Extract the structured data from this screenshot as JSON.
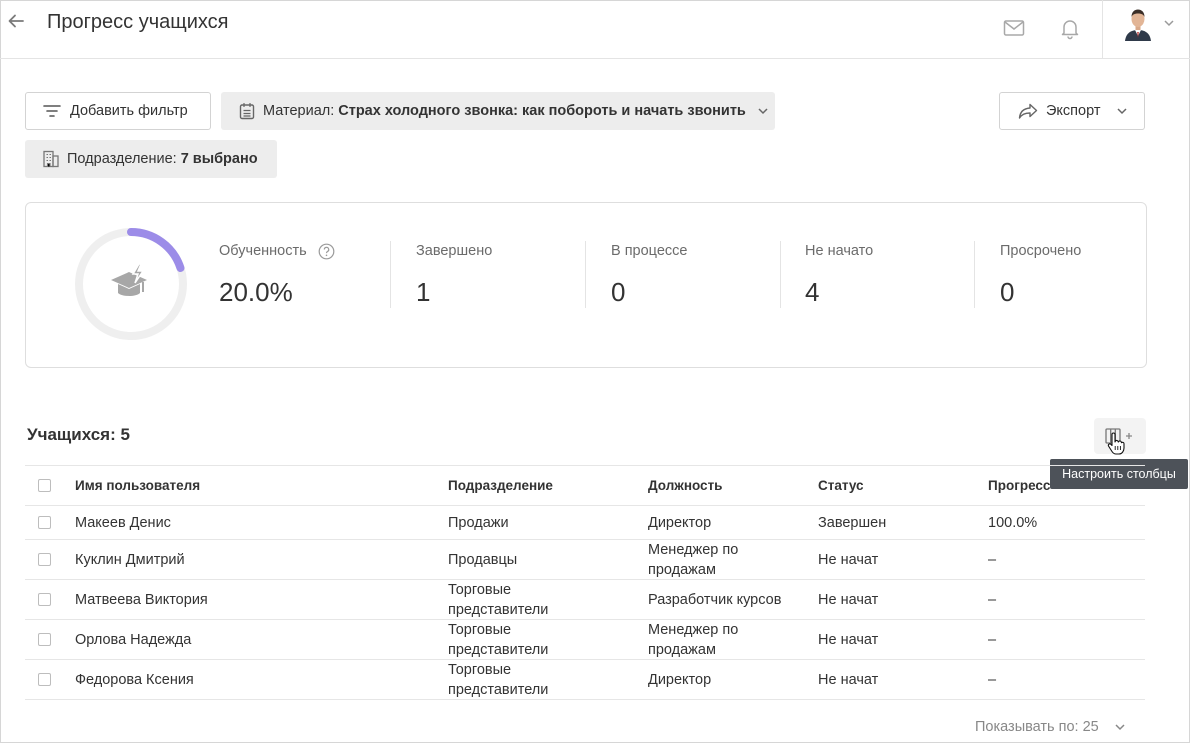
{
  "header": {
    "title": "Прогресс учащихся"
  },
  "filters": {
    "add_filter_label": "Добавить фильтр",
    "material_prefix": "Материал: ",
    "material_value": "Страх холодного звонка: как побороть и начать звонить",
    "export_label": "Экспорт",
    "department_prefix": "Подразделение: ",
    "department_value": "7 выбрано"
  },
  "stats": {
    "proficiency": {
      "label": "Обученность",
      "value": "20.0%",
      "fraction": 0.2
    },
    "completed": {
      "label": "Завершено",
      "value": "1"
    },
    "in_progress": {
      "label": "В процессе",
      "value": "0"
    },
    "not_started": {
      "label": "Не начато",
      "value": "4"
    },
    "overdue": {
      "label": "Просрочено",
      "value": "0"
    }
  },
  "table": {
    "count_label": "Учащихся: 5",
    "configure_columns_tooltip": "Настроить столбцы",
    "columns": [
      "Имя пользователя",
      "Подразделение",
      "Должность",
      "Статус",
      "Прогресс"
    ],
    "rows": [
      {
        "name": "Макеев Денис",
        "department": "Продажи",
        "position": "Директор",
        "status": "Завершен",
        "progress": "100.0%"
      },
      {
        "name": "Куклин Дмитрий",
        "department": "Продавцы",
        "position": "Менеджер по продажам",
        "status": "Не начат",
        "progress": "–"
      },
      {
        "name": "Матвеева Виктория",
        "department": "Торговые представители",
        "position": "Разработчик курсов",
        "status": "Не начат",
        "progress": "–"
      },
      {
        "name": "Орлова Надежда",
        "department": "Торговые представители",
        "position": "Менеджер по продажам",
        "status": "Не начат",
        "progress": "–"
      },
      {
        "name": "Федорова Ксения",
        "department": "Торговые представители",
        "position": "Директор",
        "status": "Не начат",
        "progress": "–"
      }
    ],
    "page_size_label": "Показывать по: 25"
  },
  "colors": {
    "accent": "#9c8ce8",
    "track": "#efefef"
  },
  "icons": [
    "back-arrow-icon",
    "mail-icon",
    "bell-icon",
    "chevron-down-icon",
    "filter-icon",
    "calendar-icon",
    "share-icon",
    "building-icon",
    "graduation-cap-icon",
    "help-icon",
    "columns-add-icon"
  ]
}
